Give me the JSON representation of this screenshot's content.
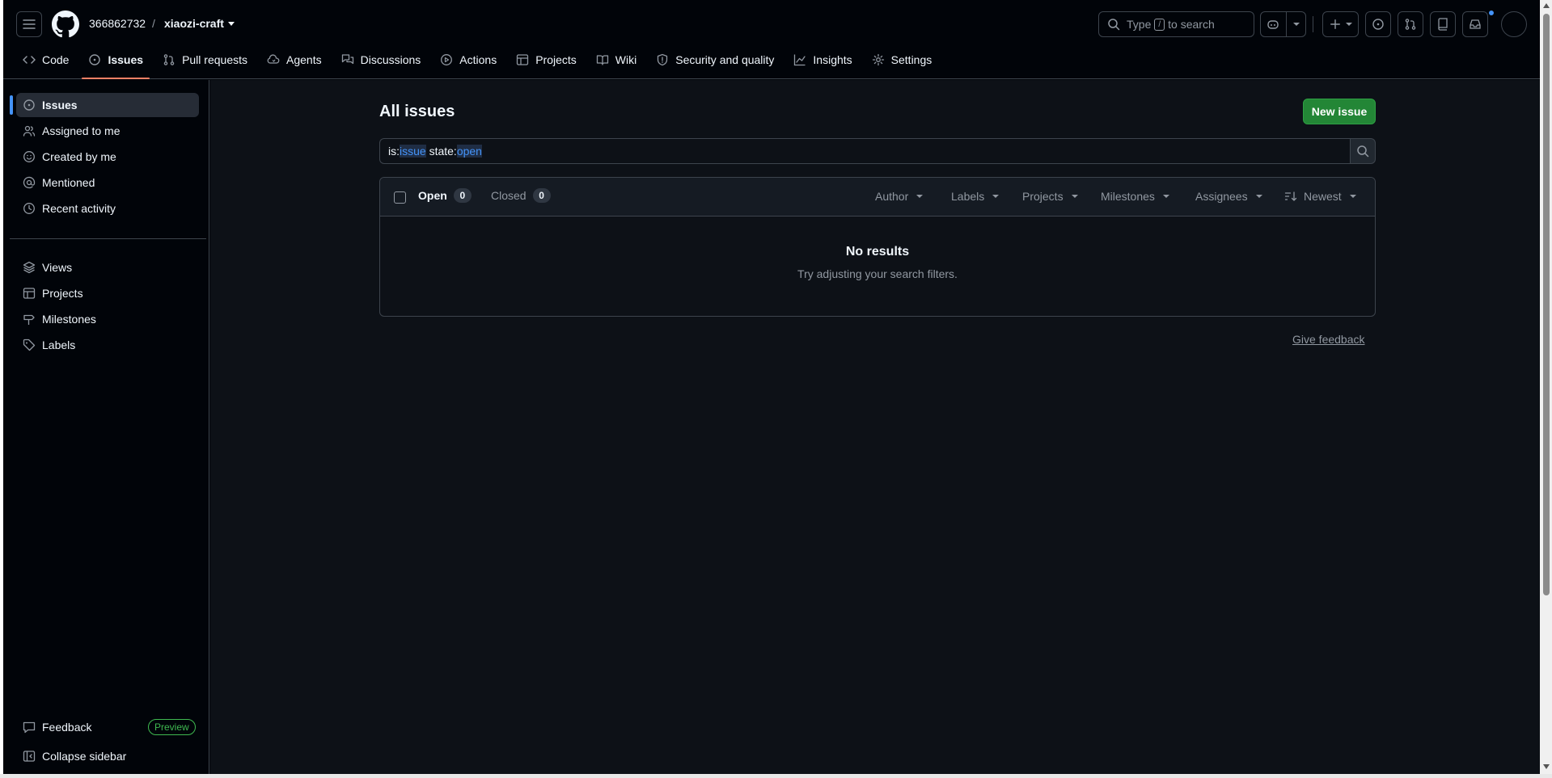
{
  "header": {
    "owner": "366862732",
    "separator": "/",
    "repo": "xiaozi-craft",
    "search": {
      "prefix": "Type",
      "key": "/",
      "suffix": "to search"
    }
  },
  "tabs": [
    {
      "label": "Code",
      "icon": "code-icon"
    },
    {
      "label": "Issues",
      "icon": "issue-opened-icon",
      "active": true
    },
    {
      "label": "Pull requests",
      "icon": "git-pull-request-icon"
    },
    {
      "label": "Agents",
      "icon": "agent-icon"
    },
    {
      "label": "Discussions",
      "icon": "comment-discussion-icon"
    },
    {
      "label": "Actions",
      "icon": "play-icon"
    },
    {
      "label": "Projects",
      "icon": "table-icon"
    },
    {
      "label": "Wiki",
      "icon": "book-icon"
    },
    {
      "label": "Security and quality",
      "icon": "shield-icon"
    },
    {
      "label": "Insights",
      "icon": "graph-icon"
    },
    {
      "label": "Settings",
      "icon": "gear-icon"
    }
  ],
  "sidebar": {
    "items": [
      {
        "label": "Issues",
        "icon": "issue-opened-icon",
        "active": true
      },
      {
        "label": "Assigned to me",
        "icon": "people-icon"
      },
      {
        "label": "Created by me",
        "icon": "smiley-icon"
      },
      {
        "label": "Mentioned",
        "icon": "mention-icon"
      },
      {
        "label": "Recent activity",
        "icon": "clock-icon"
      }
    ],
    "secondary": [
      {
        "label": "Views",
        "icon": "stack-icon"
      },
      {
        "label": "Projects",
        "icon": "table-icon"
      },
      {
        "label": "Milestones",
        "icon": "milestone-icon"
      },
      {
        "label": "Labels",
        "icon": "tag-icon"
      }
    ],
    "feedback": {
      "label": "Feedback",
      "badge": "Preview"
    },
    "collapse": "Collapse sidebar"
  },
  "main": {
    "title": "All issues",
    "new_issue": "New issue",
    "query": {
      "k1": "is:",
      "v1": "issue",
      "k2": "state:",
      "v2": "open"
    },
    "open": {
      "label": "Open",
      "count": "0"
    },
    "closed": {
      "label": "Closed",
      "count": "0"
    },
    "filters": [
      "Author",
      "Labels",
      "Projects",
      "Milestones",
      "Assignees"
    ],
    "sort": "Newest",
    "empty_title": "No results",
    "empty_sub": "Try adjusting your search filters.",
    "give_feedback": "Give feedback"
  },
  "colors": {
    "background": "#010409",
    "main_background": "#0d1117",
    "accent_blue": "#4493f8",
    "tab_underline": "#f78166",
    "primary_button": "#238636",
    "preview_green": "#3fb950"
  }
}
